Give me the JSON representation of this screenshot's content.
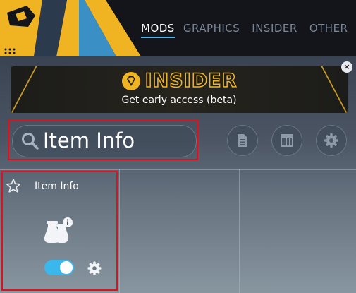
{
  "nav": {
    "items": [
      {
        "label": "MODS",
        "active": true
      },
      {
        "label": "GRAPHICS",
        "active": false
      },
      {
        "label": "INSIDER",
        "active": false
      },
      {
        "label": "OTHER",
        "active": false
      }
    ]
  },
  "banner": {
    "title": "INSIDER",
    "subtitle": "Get early access (beta)",
    "close_label": "×"
  },
  "search": {
    "value": "Item Info"
  },
  "toolbar": {
    "icons": [
      "file-list-icon",
      "layout-icon",
      "gear-icon"
    ]
  },
  "mod_card": {
    "name": "Item Info",
    "favorite": false,
    "enabled": true,
    "icon": "flask-info-icon"
  },
  "colors": {
    "accent": "#3ab8ec",
    "gold": "#f0b422",
    "highlight": "#e0101c"
  }
}
